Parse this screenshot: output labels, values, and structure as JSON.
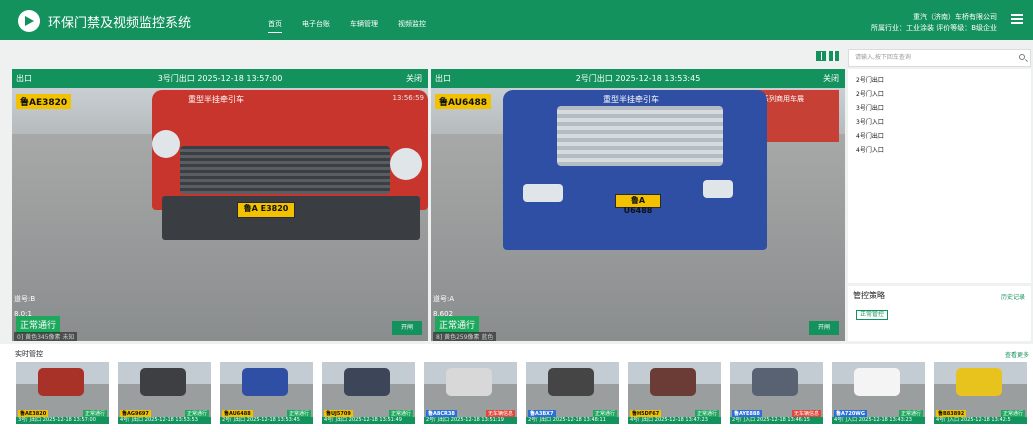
{
  "header": {
    "title": "环保门禁及视频监控系统",
    "nav": [
      "首页",
      "电子台账",
      "车辆管理",
      "视频监控"
    ],
    "company": "重汽（济南）车桥有限公司",
    "industry": "所属行业：工业涂装 评价等级：B级企业"
  },
  "search": {
    "placeholder": "请输入,按下回车查询"
  },
  "gates": [
    "2号门出口",
    "2号门入口",
    "3号门出口",
    "3号门入口",
    "4号门出口",
    "4号门入口"
  ],
  "strategy": {
    "title": "管控策略",
    "history": "历史记录",
    "mode": "正常管控"
  },
  "panels": [
    {
      "dir": "出口",
      "gate_time": "3号门出口 2025-12-18 13:57:00",
      "close": "关闭",
      "plate": "鲁AE3820",
      "plate_on_truck": "鲁A E3820",
      "truck_label": "重型半挂牵引车",
      "ts_overlay": "13:56:59",
      "lane": "道号:B",
      "spd": "8.0:1",
      "status": "正常通行",
      "info": "0] 黄色345像素 未知",
      "open": "开闸"
    },
    {
      "dir": "出口",
      "gate_time": "2号门出口 2025-12-18 13:53:45",
      "close": "关闭",
      "plate": "鲁AU6488",
      "plate_on_truck": "鲁A U6488",
      "truck_label": "重型半挂牵引车",
      "billboard": "共享全系列商用车展",
      "lane": "道号:A",
      "spd": "8.602",
      "status": "正常通行",
      "info": "8] 黄色259像素 蓝色",
      "open": "开闸"
    }
  ],
  "realtime": {
    "title": "实时管控",
    "more": "查看更多"
  },
  "thumbs": [
    {
      "plate": "鲁AE3820",
      "status": "正常通行",
      "caption": "3号门出口 2025-12-18 13:57:00",
      "plate_color": "#f2c200",
      "status_color": "#1ea85d",
      "veh": "#a83228"
    },
    {
      "plate": "鲁AG9697",
      "status": "正常通行",
      "caption": "4号门出口 2025-12-18 13:53:53",
      "plate_color": "#f2c200",
      "status_color": "#1ea85d",
      "veh": "#3d3f42"
    },
    {
      "plate": "鲁AU6488",
      "status": "正常通行",
      "caption": "2号门出口 2025-12-18 13:53:45",
      "plate_color": "#f2c200",
      "status_color": "#1ea85d",
      "veh": "#2e4fa3"
    },
    {
      "plate": "鲁UJ5709",
      "status": "正常通行",
      "caption": "4号门出口 2025-12-18 13:51:49",
      "plate_color": "#f2c200",
      "status_color": "#1ea85d",
      "veh": "#3d4658"
    },
    {
      "plate": "鲁A8CR38",
      "status": "无车辆信息",
      "caption": "2号门出口 2025-12-18 13:51:19",
      "plate_color": "#2d6fd8",
      "status_color": "#e0473d",
      "veh": "#d8d8d8"
    },
    {
      "plate": "鲁A3BX7",
      "status": "正常通行",
      "caption": "2号门出口 2025-12-18 13:48:11",
      "plate_color": "#2d6fd8",
      "status_color": "#1ea85d",
      "veh": "#454545"
    },
    {
      "plate": "鲁H5DF67",
      "status": "正常通行",
      "caption": "4号门出口 2025-12-18 13:47:23",
      "plate_color": "#f2c200",
      "status_color": "#1ea85d",
      "veh": "#6b3b35"
    },
    {
      "plate": "鲁AYE888",
      "status": "无车辆信息",
      "caption": "2号门入口 2025-12-18 13:46:15",
      "plate_color": "#2d6fd8",
      "status_color": "#e0473d",
      "veh": "#596273"
    },
    {
      "plate": "鲁A720WG",
      "status": "正常通行",
      "caption": "4号门入口 2025-12-18 13:43:23",
      "plate_color": "#2d6fd8",
      "status_color": "#1ea85d",
      "veh": "#f4f4f4"
    },
    {
      "plate": "鲁B83892",
      "status": "正常通行",
      "caption": "4号门入口 2025-12-18 13:42:5",
      "plate_color": "#f2c200",
      "status_color": "#1ea85d",
      "veh": "#e8c21d"
    }
  ]
}
